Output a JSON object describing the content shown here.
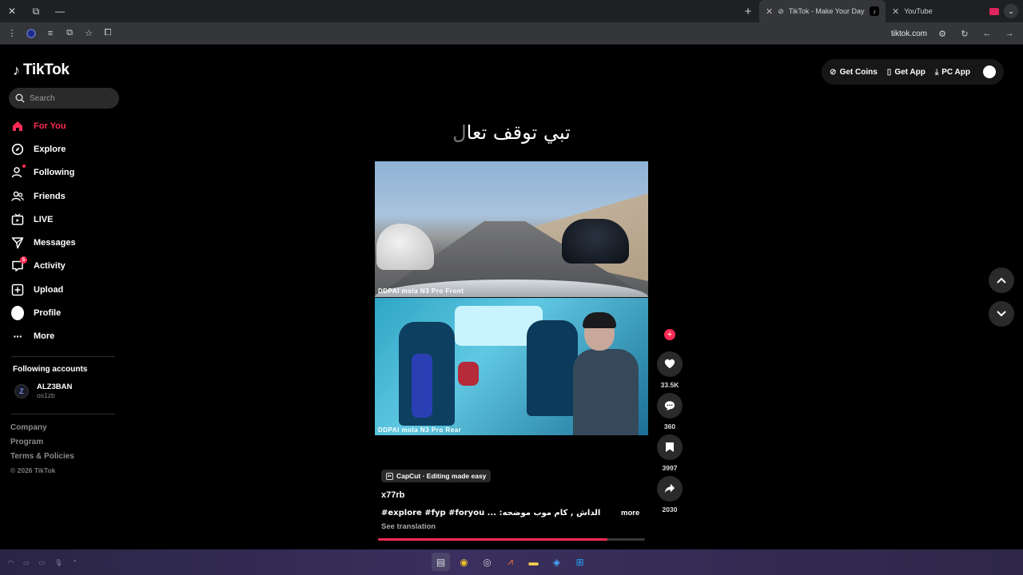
{
  "browser": {
    "tabs": [
      {
        "title": "TikTok - Make Your Day",
        "active": true
      },
      {
        "title": "YouTube",
        "active": false
      }
    ],
    "url": "tiktok.com"
  },
  "sidebar": {
    "logo_text": "TikTok",
    "search_placeholder": "Search",
    "nav": [
      {
        "label": "For You",
        "icon": "home-icon",
        "active": true
      },
      {
        "label": "Explore",
        "icon": "compass-icon"
      },
      {
        "label": "Following",
        "icon": "user-following-icon"
      },
      {
        "label": "Friends",
        "icon": "friends-icon"
      },
      {
        "label": "LIVE",
        "icon": "live-tv-icon"
      },
      {
        "label": "Messages",
        "icon": "paper-plane-icon"
      },
      {
        "label": "Activity",
        "icon": "activity-icon",
        "badge": "5"
      },
      {
        "label": "Upload",
        "icon": "plus-square-icon"
      },
      {
        "label": "Profile",
        "icon": "avatar-icon"
      },
      {
        "label": "More",
        "icon": "more-dots-icon"
      }
    ],
    "following_title": "Following accounts",
    "following": [
      {
        "name": "ALZ3BAN",
        "handle": "os1zb",
        "avatar_letter": "Z"
      }
    ],
    "footer": [
      "Company",
      "Program",
      "Terms & Policies"
    ],
    "copyright": "© 2026 TikTok"
  },
  "header": {
    "get_coins": "Get Coins",
    "get_app": "Get App",
    "pc_app": "PC App"
  },
  "video": {
    "overlay_text": "تبي توقف تعا",
    "overlay_text_dim": "ل",
    "front_label": "DDPAI mola N3 Pro Front",
    "rear_label": "DDPAI mola N3 Pro Rear",
    "likes": "33.5K",
    "comments": "360",
    "saves": "3997",
    "shares": "2030",
    "progress": 0.86
  },
  "caption": {
    "capcut": "CapCut · Editing made easy",
    "author": "x77rb",
    "text": "#explore #fyp #foryou ... :ترا لف يسار يس , الداش , كام موب موضحه",
    "more": "more",
    "see_translation": "See translation"
  },
  "colors": {
    "accent": "#fe2c55",
    "background": "#000000"
  }
}
